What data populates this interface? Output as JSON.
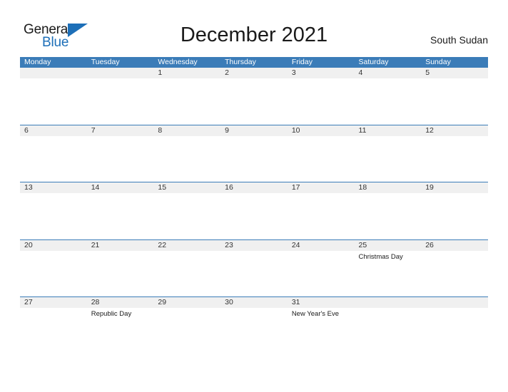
{
  "brand": {
    "name_part1": "General",
    "name_part2": "Blue",
    "flag_icon": "blue-triangle-flag",
    "color_primary": "#1d6fb8",
    "color_text": "#1a1a1a"
  },
  "header": {
    "title": "December 2021",
    "locale": "South Sudan"
  },
  "calendar": {
    "accent_color": "#3b7cb8",
    "band_color": "#f0f0f0",
    "weekdays": [
      "Monday",
      "Tuesday",
      "Wednesday",
      "Thursday",
      "Friday",
      "Saturday",
      "Sunday"
    ],
    "weeks": [
      [
        {
          "num": "",
          "event": ""
        },
        {
          "num": "",
          "event": ""
        },
        {
          "num": "1",
          "event": ""
        },
        {
          "num": "2",
          "event": ""
        },
        {
          "num": "3",
          "event": ""
        },
        {
          "num": "4",
          "event": ""
        },
        {
          "num": "5",
          "event": ""
        }
      ],
      [
        {
          "num": "6",
          "event": ""
        },
        {
          "num": "7",
          "event": ""
        },
        {
          "num": "8",
          "event": ""
        },
        {
          "num": "9",
          "event": ""
        },
        {
          "num": "10",
          "event": ""
        },
        {
          "num": "11",
          "event": ""
        },
        {
          "num": "12",
          "event": ""
        }
      ],
      [
        {
          "num": "13",
          "event": ""
        },
        {
          "num": "14",
          "event": ""
        },
        {
          "num": "15",
          "event": ""
        },
        {
          "num": "16",
          "event": ""
        },
        {
          "num": "17",
          "event": ""
        },
        {
          "num": "18",
          "event": ""
        },
        {
          "num": "19",
          "event": ""
        }
      ],
      [
        {
          "num": "20",
          "event": ""
        },
        {
          "num": "21",
          "event": ""
        },
        {
          "num": "22",
          "event": ""
        },
        {
          "num": "23",
          "event": ""
        },
        {
          "num": "24",
          "event": ""
        },
        {
          "num": "25",
          "event": "Christmas Day"
        },
        {
          "num": "26",
          "event": ""
        }
      ],
      [
        {
          "num": "27",
          "event": ""
        },
        {
          "num": "28",
          "event": "Republic Day"
        },
        {
          "num": "29",
          "event": ""
        },
        {
          "num": "30",
          "event": ""
        },
        {
          "num": "31",
          "event": "New Year's Eve"
        },
        {
          "num": "",
          "event": ""
        },
        {
          "num": "",
          "event": ""
        }
      ]
    ]
  }
}
